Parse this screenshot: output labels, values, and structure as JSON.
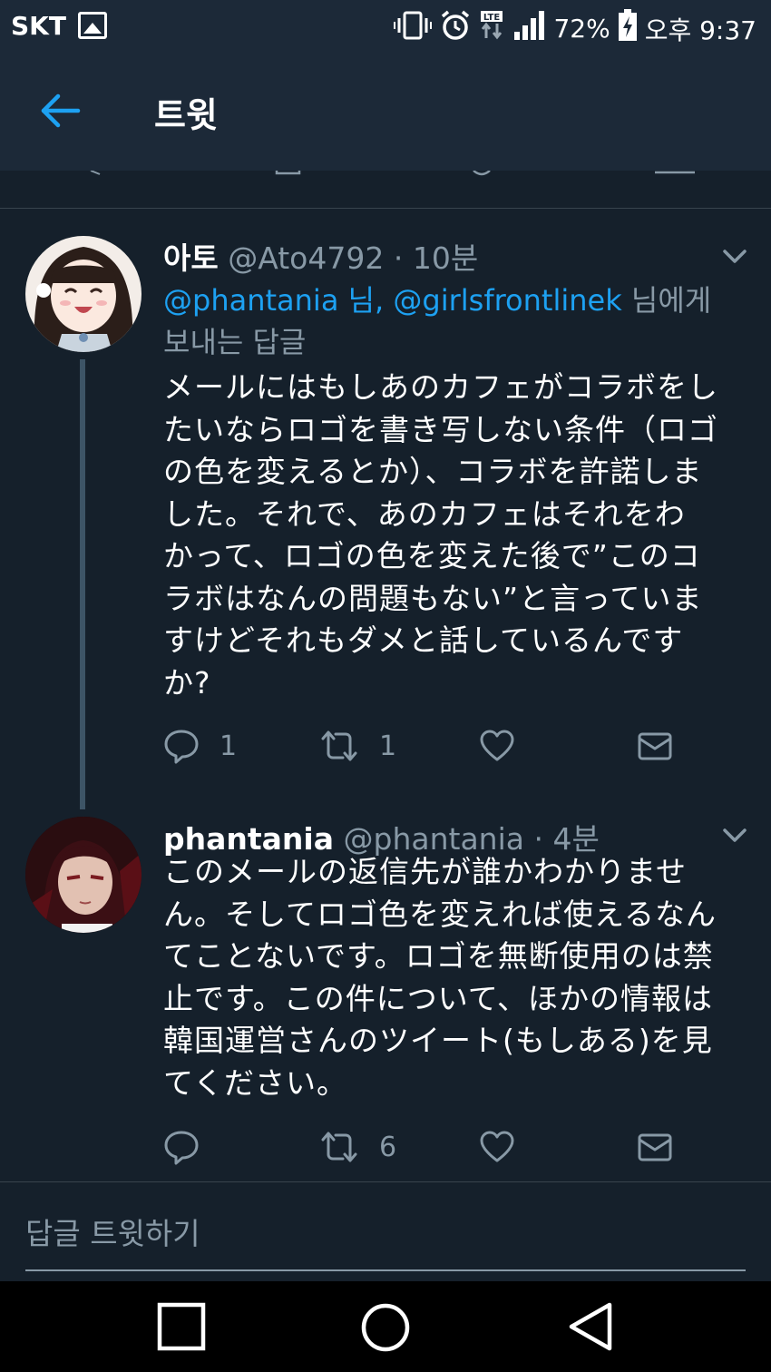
{
  "status_bar": {
    "carrier": "SKT",
    "network": "LTE",
    "battery": "72%",
    "time": "오후 9:37",
    "icons": [
      "image-icon",
      "vibrate-icon",
      "alarm-icon",
      "lte-icon",
      "signal-icon",
      "battery-charging-icon"
    ]
  },
  "header": {
    "title": "트윗",
    "back_icon": "arrow-left-icon"
  },
  "tweets": [
    {
      "name": "아토",
      "handle": "@Ato4792",
      "time": "· 10분",
      "reply_to_prefix": "",
      "mention1": "@phantania 님,",
      "mention2": "@girlsfrontlinek",
      "reply_to_suffix": "님에게",
      "reply_to_label": "보내는 답글",
      "body_lines": [
        "メールにはもしあのカフェがコラボをし",
        "たいならロゴを書き写しない条件（ロゴ",
        "の色を変えるとか）、コラボを許諾しま",
        "した。それで、あのカフェはそれをわ",
        "かって、ロゴの色を変えた後で”このコ",
        "ラボはなんの問題もない”と言っていま",
        "すけどそれもダメと話しているんです",
        "か?"
      ],
      "reply_count": "1",
      "retweet_count": "1",
      "like_count": "",
      "avatar_colors": [
        "#2b1e19",
        "#f3e9e1",
        "#ffffff"
      ]
    },
    {
      "name": "phantania",
      "handle": "@phantania",
      "time": "· 4분",
      "body_lines": [
        "このメールの返信先が誰かわかりませ",
        "ん。そしてロゴ色を変えれば使えるなん",
        "てことないです。ロゴを無断使用のは禁",
        "止です。この件について、ほかの情報は",
        "韓国運営さんのツイート(もしある)を見",
        "てください。"
      ],
      "reply_count": "",
      "retweet_count": "6",
      "like_count": "",
      "avatar_colors": [
        "#2a0d10",
        "#d9b7a6",
        "#7a1b20"
      ]
    }
  ],
  "reply_bar": {
    "placeholder": "답글 트윗하기"
  },
  "nav": {
    "buttons": [
      "recent-apps-icon",
      "home-icon",
      "back-triangle-icon"
    ]
  },
  "colors": {
    "background": "#15202b",
    "header": "#1c2938",
    "accent": "#1da1f2",
    "muted": "#8899a6",
    "divider": "#38444d"
  }
}
